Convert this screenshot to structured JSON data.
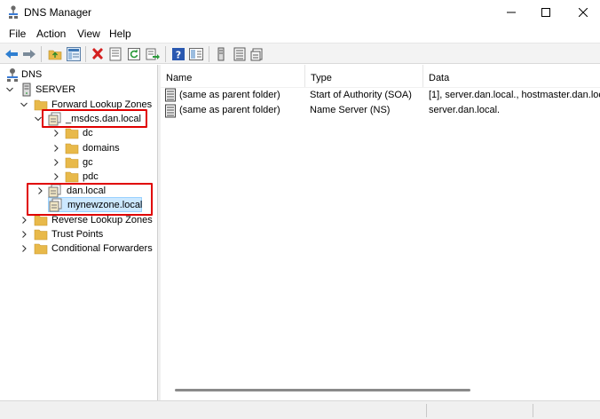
{
  "window": {
    "title": "DNS Manager"
  },
  "menu": [
    "File",
    "Action",
    "View",
    "Help"
  ],
  "toolbar": {
    "icons": [
      "back-arrow-icon",
      "forward-arrow-icon",
      "up-folder-icon",
      "show-hide-console-tree-icon",
      "delete-icon",
      "properties-icon",
      "refresh-icon",
      "export-list-icon",
      "help-icon",
      "show-action-pane-icon",
      "server-icon",
      "records-icon",
      "zone-icon"
    ]
  },
  "tree": {
    "root": "DNS",
    "server": "SERVER",
    "forward_lookup_zones": "Forward Lookup Zones",
    "msdcs_zone": "_msdcs.dan.local",
    "msdcs_children": [
      "dc",
      "domains",
      "gc",
      "pdc"
    ],
    "dan_local": "dan.local",
    "mynewzone": "mynewzone.local",
    "reverse_lookup_zones": "Reverse Lookup Zones",
    "trust_points": "Trust Points",
    "conditional_forwarders": "Conditional Forwarders"
  },
  "list": {
    "columns": [
      "Name",
      "Type",
      "Data"
    ],
    "rows": [
      {
        "name": "(same as parent folder)",
        "type": "Start of Authority (SOA)",
        "data": "[1], server.dan.local., hostmaster.dan.loc"
      },
      {
        "name": "(same as parent folder)",
        "type": "Name Server (NS)",
        "data": "server.dan.local."
      }
    ]
  },
  "colors": {
    "selection": "#cce8ff",
    "annotation_box": "#e00000",
    "folder": "#e8b94a"
  }
}
